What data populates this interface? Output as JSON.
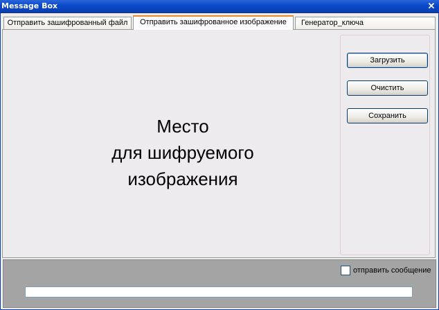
{
  "window": {
    "title": "Message Box",
    "close_symbol": "✕"
  },
  "tabs": [
    {
      "label": "Отправить зашифрованный файл",
      "active": false
    },
    {
      "label": "Отправить зашифрованное изображение",
      "active": true
    },
    {
      "label": "Генератор_ключа",
      "active": false
    }
  ],
  "image_area": {
    "line1": "Место",
    "line2": "для шифруемого",
    "line3": "изображения"
  },
  "buttons": {
    "load": "Загрузить",
    "clear": "Очистить",
    "save": "Сохранить"
  },
  "bottom": {
    "checkbox_label": "отправить сообщение",
    "checkbox_checked": false,
    "message_value": ""
  }
}
